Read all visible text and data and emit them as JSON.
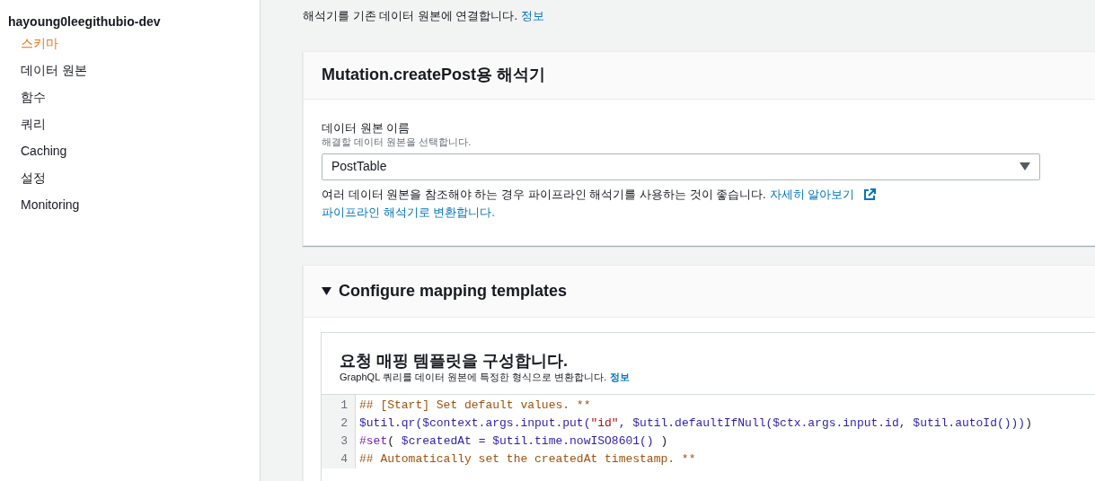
{
  "sidebar": {
    "api_name": "hayoung0leegithubio-dev",
    "items": [
      {
        "label": "스키마",
        "selected": true
      },
      {
        "label": "데이터 원본",
        "selected": false
      },
      {
        "label": "함수",
        "selected": false
      },
      {
        "label": "쿼리",
        "selected": false
      },
      {
        "label": "Caching",
        "selected": false
      },
      {
        "label": "설정",
        "selected": false
      },
      {
        "label": "Monitoring",
        "selected": false
      }
    ]
  },
  "intro": {
    "text": "해석기를 기존 데이터 원본에 연결합니다.",
    "info_link": "정보"
  },
  "resolver_card": {
    "title": "Mutation.createPost용 해석기",
    "field_label": "데이터 원본 이름",
    "field_hint": "해결할 데이터 원본을 선택합니다.",
    "select_value": "PostTable",
    "note": "여러 데이터 원본을 참조해야 하는 경우 파이프라인 해석기를 사용하는 것이 좋습니다.",
    "learn_more_link": "자세히 알아보기",
    "convert_link": "파이프라인 해석기로 변환합니다."
  },
  "mapping_section": {
    "title": "Configure mapping templates",
    "expanded": true,
    "request_template": {
      "title": "요청 매핑 템플릿을 구성합니다.",
      "description": "GraphQL 쿼리를 데이터 원본에 특정한 형식으로 변환합니다.",
      "info_link": "정보",
      "code_lines": [
        {
          "number": "1",
          "tokens": [
            {
              "kind": "comment",
              "text": "## [Start] Set default values. **"
            }
          ]
        },
        {
          "number": "2",
          "tokens": [
            {
              "kind": "variable",
              "text": "$util.qr($context.args.input.put("
            },
            {
              "kind": "string",
              "text": "\"id\""
            },
            {
              "kind": "variable",
              "text": ", $util.defaultIfNull($ctx.args.input.id, $util.autoId()))"
            },
            {
              "kind": "plain",
              "text": ")"
            }
          ]
        },
        {
          "number": "3",
          "tokens": [
            {
              "kind": "directive",
              "text": "#set"
            },
            {
              "kind": "plain",
              "text": "( "
            },
            {
              "kind": "variable",
              "text": "$createdAt = $util.time.nowISO8601() "
            },
            {
              "kind": "plain",
              "text": ")"
            }
          ]
        },
        {
          "number": "4",
          "tokens": [
            {
              "kind": "comment",
              "text": "## Automatically set the createdAt timestamp. **"
            }
          ]
        }
      ]
    }
  }
}
